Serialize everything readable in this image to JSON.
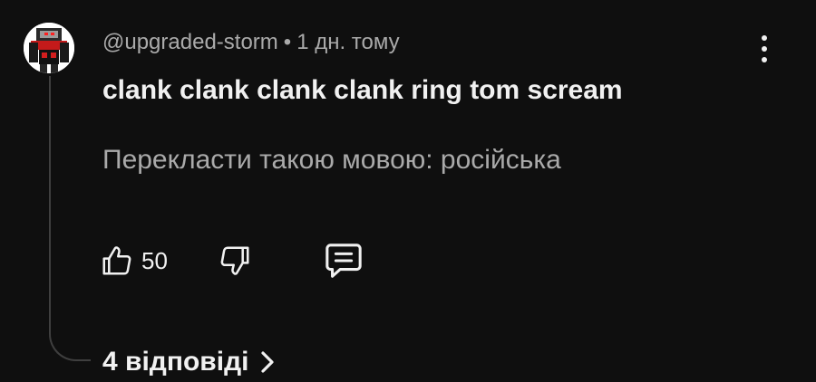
{
  "comment": {
    "author": "@upgraded-storm",
    "separator": "•",
    "timestamp": "1 дн. тому",
    "text": "clank clank clank clank ring tom scream",
    "translate_label": "Перекласти такою мовою: російська",
    "like_count": "50",
    "replies_label": "4 відповіді"
  },
  "icons": {
    "more": "more-vert-icon",
    "like": "thumb-up-icon",
    "dislike": "thumb-down-icon",
    "reply": "comment-icon",
    "chevron": "chevron-right-icon"
  },
  "colors": {
    "background": "#0f0f0f",
    "primary_text": "#f1f1f1",
    "secondary_text": "#aaaaaa",
    "thread_line": "#3f3f3f"
  }
}
